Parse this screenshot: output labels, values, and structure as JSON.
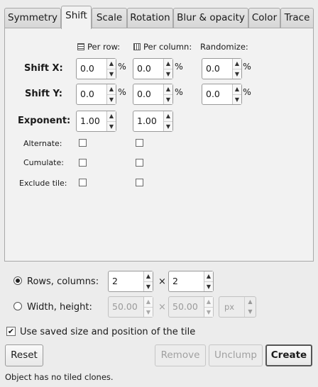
{
  "tabs": [
    {
      "label": "Symmetry",
      "active": false
    },
    {
      "label": "Shift",
      "active": true
    },
    {
      "label": "Scale",
      "active": false
    },
    {
      "label": "Rotation",
      "active": false
    },
    {
      "label": "Blur & opacity",
      "active": false
    },
    {
      "label": "Color",
      "active": false
    },
    {
      "label": "Trace",
      "active": false
    }
  ],
  "shift": {
    "col_headers": {
      "per_row": "Per row:",
      "per_column": "Per column:",
      "randomize": "Randomize:"
    },
    "shift_x": {
      "label": "Shift X:",
      "per_row": "0.0",
      "per_column": "0.0",
      "randomize": "0.0"
    },
    "shift_y": {
      "label": "Shift Y:",
      "per_row": "0.0",
      "per_column": "0.0",
      "randomize": "0.0"
    },
    "exponent": {
      "label": "Exponent:",
      "per_row": "1.00",
      "per_column": "1.00"
    },
    "percent": "%",
    "alternate_label": "Alternate:",
    "cumulate_label": "Cumulate:",
    "exclude_tile_label": "Exclude tile:"
  },
  "rows_columns": {
    "label": "Rows, columns:",
    "rows": "2",
    "columns": "2",
    "times": "×",
    "selected": true
  },
  "width_height": {
    "label": "Width, height:",
    "width": "50.00",
    "height": "50.00",
    "times": "×",
    "unit": "px",
    "selected": false
  },
  "use_saved": {
    "label": "Use saved size and position of the tile",
    "checked": true
  },
  "buttons": {
    "reset": "Reset",
    "remove": "Remove",
    "unclump": "Unclump",
    "create": "Create"
  },
  "status": "Object has no tiled clones.",
  "icons": {
    "up": "▲",
    "down": "▼",
    "check": "✔"
  }
}
